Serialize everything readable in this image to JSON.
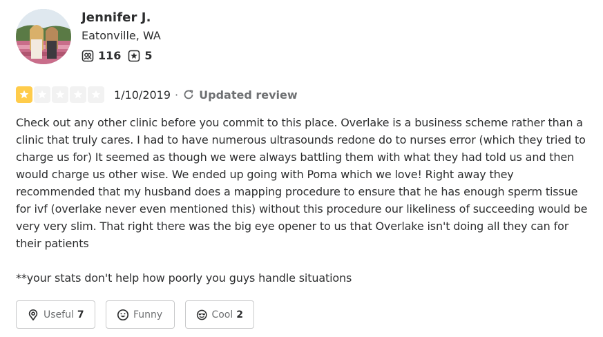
{
  "user": {
    "name": "Jennifer J.",
    "location": "Eatonville, WA",
    "friends_count": "116",
    "reviews_count": "5"
  },
  "review": {
    "rating": 1,
    "max_rating": 5,
    "date": "1/10/2019",
    "separator": "·",
    "updated_label": "Updated review",
    "paragraphs": [
      "Check out any other clinic before you commit to this place. Overlake is a business scheme rather than a clinic that truly cares. I had to have numerous ultrasounds redone do to nurses error (which they tried to charge us for) It seemed as though we were always battling them with what they had told us and then would charge us other wise. We ended up going with Poma which we love! Right away they recommended that my husband does a mapping procedure to ensure that he has enough sperm tissue for ivf (overlake never even mentioned this) without this procedure our likeliness of succeeding would be very very slim. That right there was the big eye opener to us that Overlake isn't doing all they can for their patients",
      "**your stats don't help how poorly you guys handle situations"
    ]
  },
  "actions": {
    "useful_label": "Useful",
    "useful_count": "7",
    "funny_label": "Funny",
    "cool_label": "Cool",
    "cool_count": "2"
  },
  "colors": {
    "star_active": "#ffcc4b",
    "star_inactive": "#f2f2f2",
    "text": "#2d2e2f",
    "muted": "#6e7072",
    "border": "#c8c9ca"
  },
  "icons": {
    "friends": "friends-icon",
    "reviews": "review-star-icon",
    "updated": "refresh-icon",
    "useful": "lightbulb-icon",
    "funny": "smile-icon",
    "cool": "sunglasses-icon"
  }
}
